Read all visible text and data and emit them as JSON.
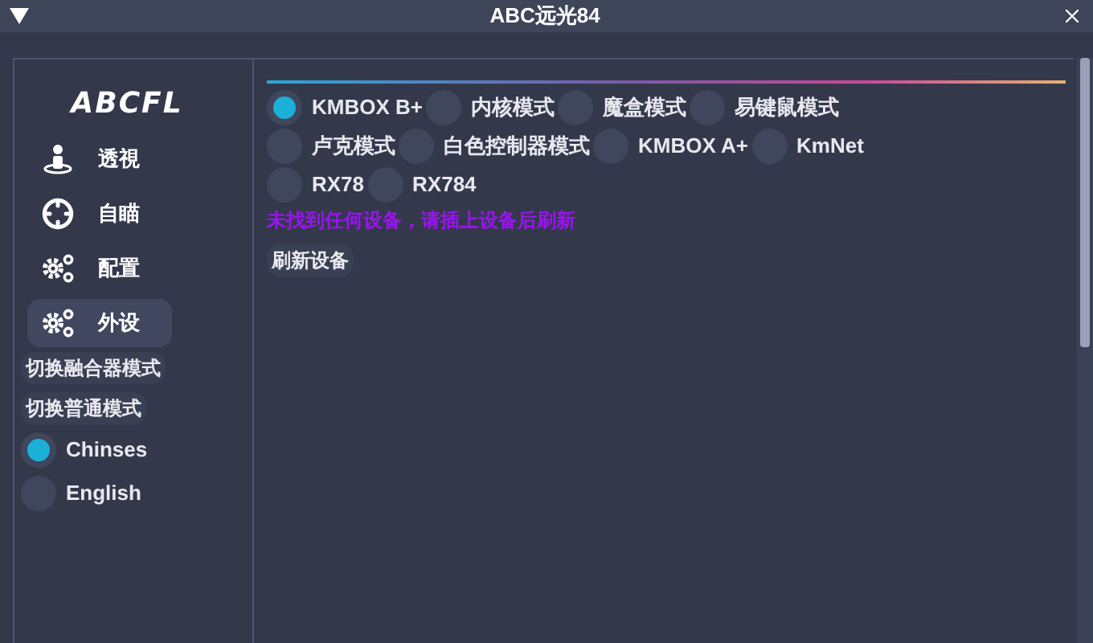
{
  "window": {
    "title": "ABC远光84"
  },
  "sidebar": {
    "logo": "ABCFL",
    "nav": [
      {
        "label": "透視",
        "kind": "person",
        "selected": false
      },
      {
        "label": "自瞄",
        "kind": "crosshair",
        "selected": false
      },
      {
        "label": "配置",
        "kind": "cogs",
        "selected": false
      },
      {
        "label": "外设",
        "kind": "cogs",
        "selected": true
      }
    ],
    "mode_buttons": [
      "切换融合器模式",
      "切换普通模式"
    ],
    "languages": [
      {
        "label": "Chinses",
        "selected": true
      },
      {
        "label": "English",
        "selected": false
      }
    ]
  },
  "devices": {
    "rows": [
      [
        {
          "label": "KMBOX B+",
          "selected": true
        },
        {
          "label": "内核模式",
          "selected": false
        },
        {
          "label": "魔盒模式",
          "selected": false
        },
        {
          "label": "易键鼠模式",
          "selected": false
        }
      ],
      [
        {
          "label": "卢克模式",
          "selected": false
        },
        {
          "label": "白色控制器模式",
          "selected": false
        },
        {
          "label": "KMBOX A+",
          "selected": false
        },
        {
          "label": "KmNet",
          "selected": false
        }
      ],
      [
        {
          "label": "RX78",
          "selected": false
        },
        {
          "label": "RX784",
          "selected": false
        }
      ]
    ],
    "message": "未找到任何设备，请插上设备后刷新",
    "refresh_button": "刷新设备"
  }
}
